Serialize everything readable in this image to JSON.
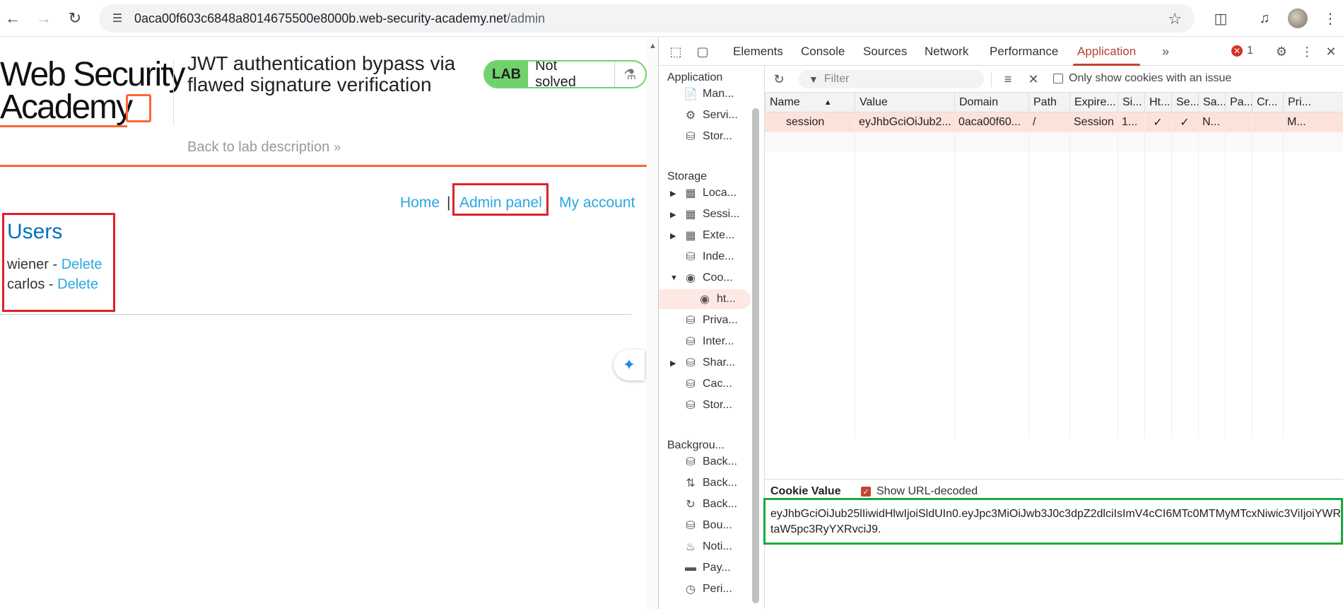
{
  "browser": {
    "url_host": "0aca00f603c6848a8014675500e8000b.web-security-academy.net",
    "url_path": "/admin"
  },
  "lab": {
    "logo_line1": "Web Security",
    "logo_line2": "Academy",
    "title": "JWT authentication bypass via flawed signature verification",
    "back_link": "Back to lab description",
    "badge_label": "LAB",
    "status": "Not solved"
  },
  "nav": {
    "home": "Home",
    "separator": "|",
    "admin_panel": "Admin panel",
    "my_account": "My account"
  },
  "users": {
    "heading": "Users",
    "list": [
      {
        "name": "wiener",
        "sep": " - ",
        "action": "Delete"
      },
      {
        "name": "carlos",
        "sep": " - ",
        "action": "Delete"
      }
    ]
  },
  "devtools": {
    "tabs": [
      "Elements",
      "Console",
      "Sources",
      "Network",
      "Performance",
      "Application"
    ],
    "active_tab": "Application",
    "error_count": "1",
    "sidebar": {
      "application_group": "Application",
      "application_items": [
        "Man...",
        "Servi...",
        "Stor..."
      ],
      "storage_group": "Storage",
      "storage_items": [
        "Loca...",
        "Sessi...",
        "Exte...",
        "Inde...",
        "Coo...",
        "ht...",
        "Priva...",
        "Inter...",
        "Shar...",
        "Cac...",
        "Stor..."
      ],
      "background_group": "Backgrou...",
      "background_items": [
        "Back...",
        "Back...",
        "Back...",
        "Bou...",
        "Noti...",
        "Pay...",
        "Peri..."
      ]
    },
    "toolbar": {
      "filter_placeholder": "Filter",
      "only_issues_label": "Only show cookies with an issue"
    },
    "table": {
      "headers": [
        "Name",
        "Value",
        "Domain",
        "Path",
        "Expire...",
        "Si...",
        "Ht...",
        "Se...",
        "Sa...",
        "Pa...",
        "Cr...",
        "Pri..."
      ],
      "row": [
        "session",
        "eyJhbGciOiJub2...",
        "0aca00f60...",
        "/",
        "Session",
        "1...",
        "✓",
        "✓",
        "N...",
        "",
        "",
        "M..."
      ]
    },
    "cookie_value": {
      "title": "Cookie Value",
      "show_decoded": "Show URL-decoded",
      "value": "eyJhbGciOiJub25lIiwidHlwIjoiSldUIn0.eyJpc3MiOiJwb3J0c3dpZ2dlciIsImV4cCI6MTc0MTMyMTcxNiwic3ViIjoiYWRtaW5pc3RyYXRvciJ9."
    },
    "colors": {
      "accent": "#c5432f",
      "row_highlight": "#fde2da"
    }
  },
  "annotations": {
    "red": "#e0202a",
    "green": "#1aaa3a"
  }
}
